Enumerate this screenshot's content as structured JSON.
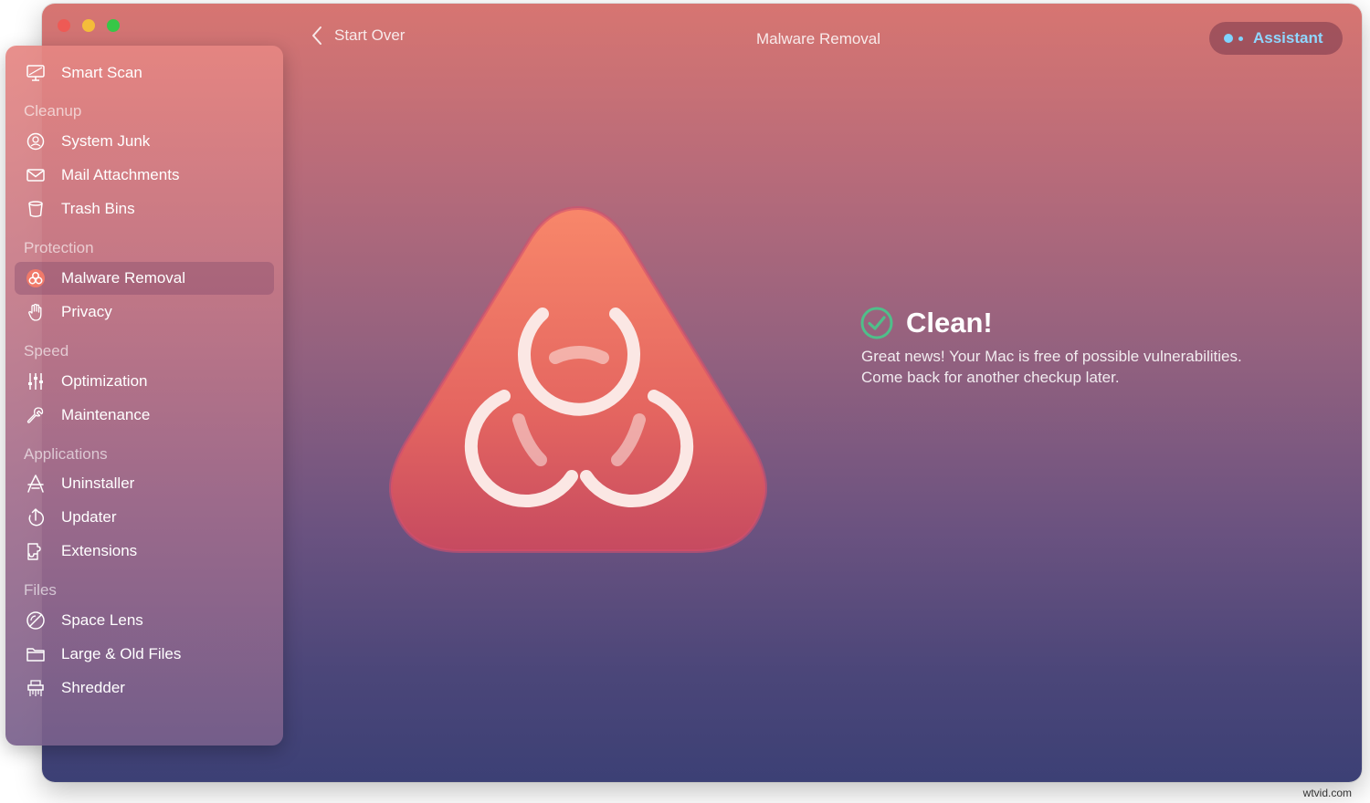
{
  "window": {
    "back_label": "Start Over",
    "title": "Malware Removal",
    "assistant_label": "Assistant"
  },
  "sidebar": {
    "top_item": {
      "label": "Smart Scan",
      "icon": "monitor-scan-icon"
    },
    "sections": [
      {
        "title": "Cleanup",
        "items": [
          {
            "label": "System Junk",
            "icon": "system-junk-icon"
          },
          {
            "label": "Mail Attachments",
            "icon": "envelope-icon"
          },
          {
            "label": "Trash Bins",
            "icon": "trash-bin-icon"
          }
        ]
      },
      {
        "title": "Protection",
        "items": [
          {
            "label": "Malware Removal",
            "icon": "biohazard-icon",
            "active": true
          },
          {
            "label": "Privacy",
            "icon": "hand-icon"
          }
        ]
      },
      {
        "title": "Speed",
        "items": [
          {
            "label": "Optimization",
            "icon": "sliders-icon"
          },
          {
            "label": "Maintenance",
            "icon": "wrench-icon"
          }
        ]
      },
      {
        "title": "Applications",
        "items": [
          {
            "label": "Uninstaller",
            "icon": "uninstaller-icon"
          },
          {
            "label": "Updater",
            "icon": "updater-icon"
          },
          {
            "label": "Extensions",
            "icon": "puzzle-icon"
          }
        ]
      },
      {
        "title": "Files",
        "items": [
          {
            "label": "Space Lens",
            "icon": "space-lens-icon"
          },
          {
            "label": "Large & Old Files",
            "icon": "folder-icon"
          },
          {
            "label": "Shredder",
            "icon": "shredder-icon"
          }
        ]
      }
    ]
  },
  "result": {
    "title": "Clean!",
    "line1": "Great news! Your Mac is free of possible vulnerabilities.",
    "line2": "Come back for another checkup later."
  },
  "watermark": "wtvid.com",
  "colors": {
    "accent_blue": "#8fd7ff",
    "check_green": "#4fbf8a",
    "hero_top": "#f8876a",
    "hero_bottom": "#c64a60"
  }
}
